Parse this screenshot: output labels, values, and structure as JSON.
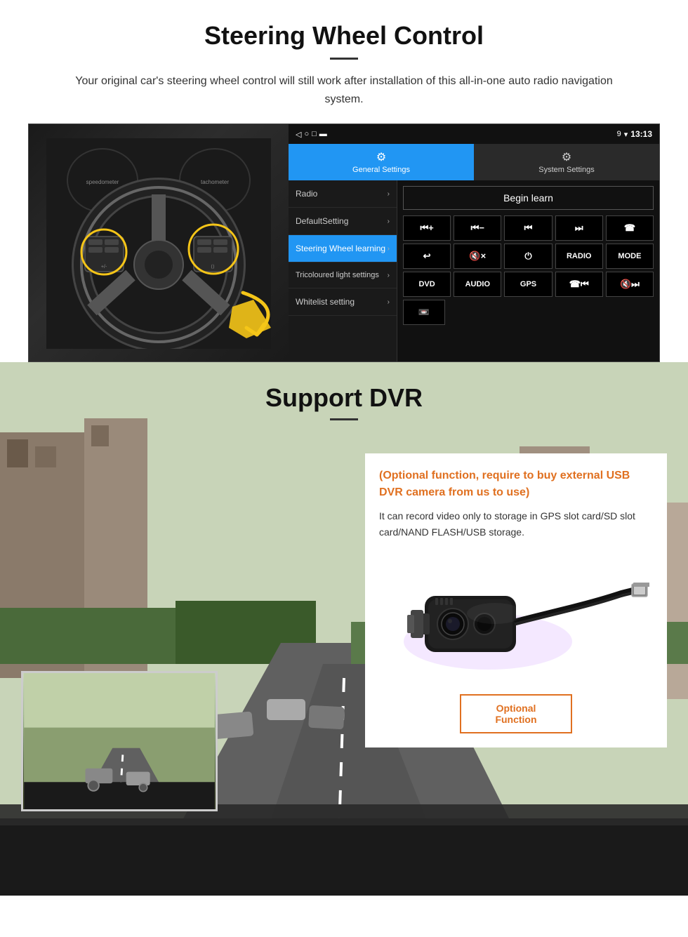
{
  "steering": {
    "title": "Steering Wheel Control",
    "subtitle": "Your original car's steering wheel control will still work after installation of this all-in-one auto radio navigation system.",
    "statusbar": {
      "time": "13:13",
      "signal_icon": "▼",
      "wifi_icon": "▾"
    },
    "tabs": [
      {
        "id": "general",
        "label": "General Settings",
        "active": true
      },
      {
        "id": "system",
        "label": "System Settings",
        "active": false
      }
    ],
    "menu": [
      {
        "id": "radio",
        "label": "Radio",
        "active": false
      },
      {
        "id": "default",
        "label": "DefaultSetting",
        "active": false
      },
      {
        "id": "steering",
        "label": "Steering Wheel learning",
        "active": true
      },
      {
        "id": "tricoloured",
        "label": "Tricoloured light settings",
        "active": false
      },
      {
        "id": "whitelist",
        "label": "Whitelist setting",
        "active": false
      }
    ],
    "begin_learn": "Begin learn",
    "controls": [
      [
        "⏮+",
        "⏮-",
        "⏮◀",
        "⏭▶",
        "☎"
      ],
      [
        "↩",
        "🔇×",
        "⏻",
        "RADIO",
        "MODE"
      ],
      [
        "DVD",
        "AUDIO",
        "GPS",
        "☎⏮",
        "🔇⏭"
      ],
      [
        "📼"
      ]
    ]
  },
  "dvr": {
    "title": "Support DVR",
    "optional_title": "(Optional function, require to buy external USB DVR camera from us to use)",
    "description": "It can record video only to storage in GPS slot card/SD slot card/NAND FLASH/USB storage.",
    "optional_btn": "Optional Function"
  }
}
